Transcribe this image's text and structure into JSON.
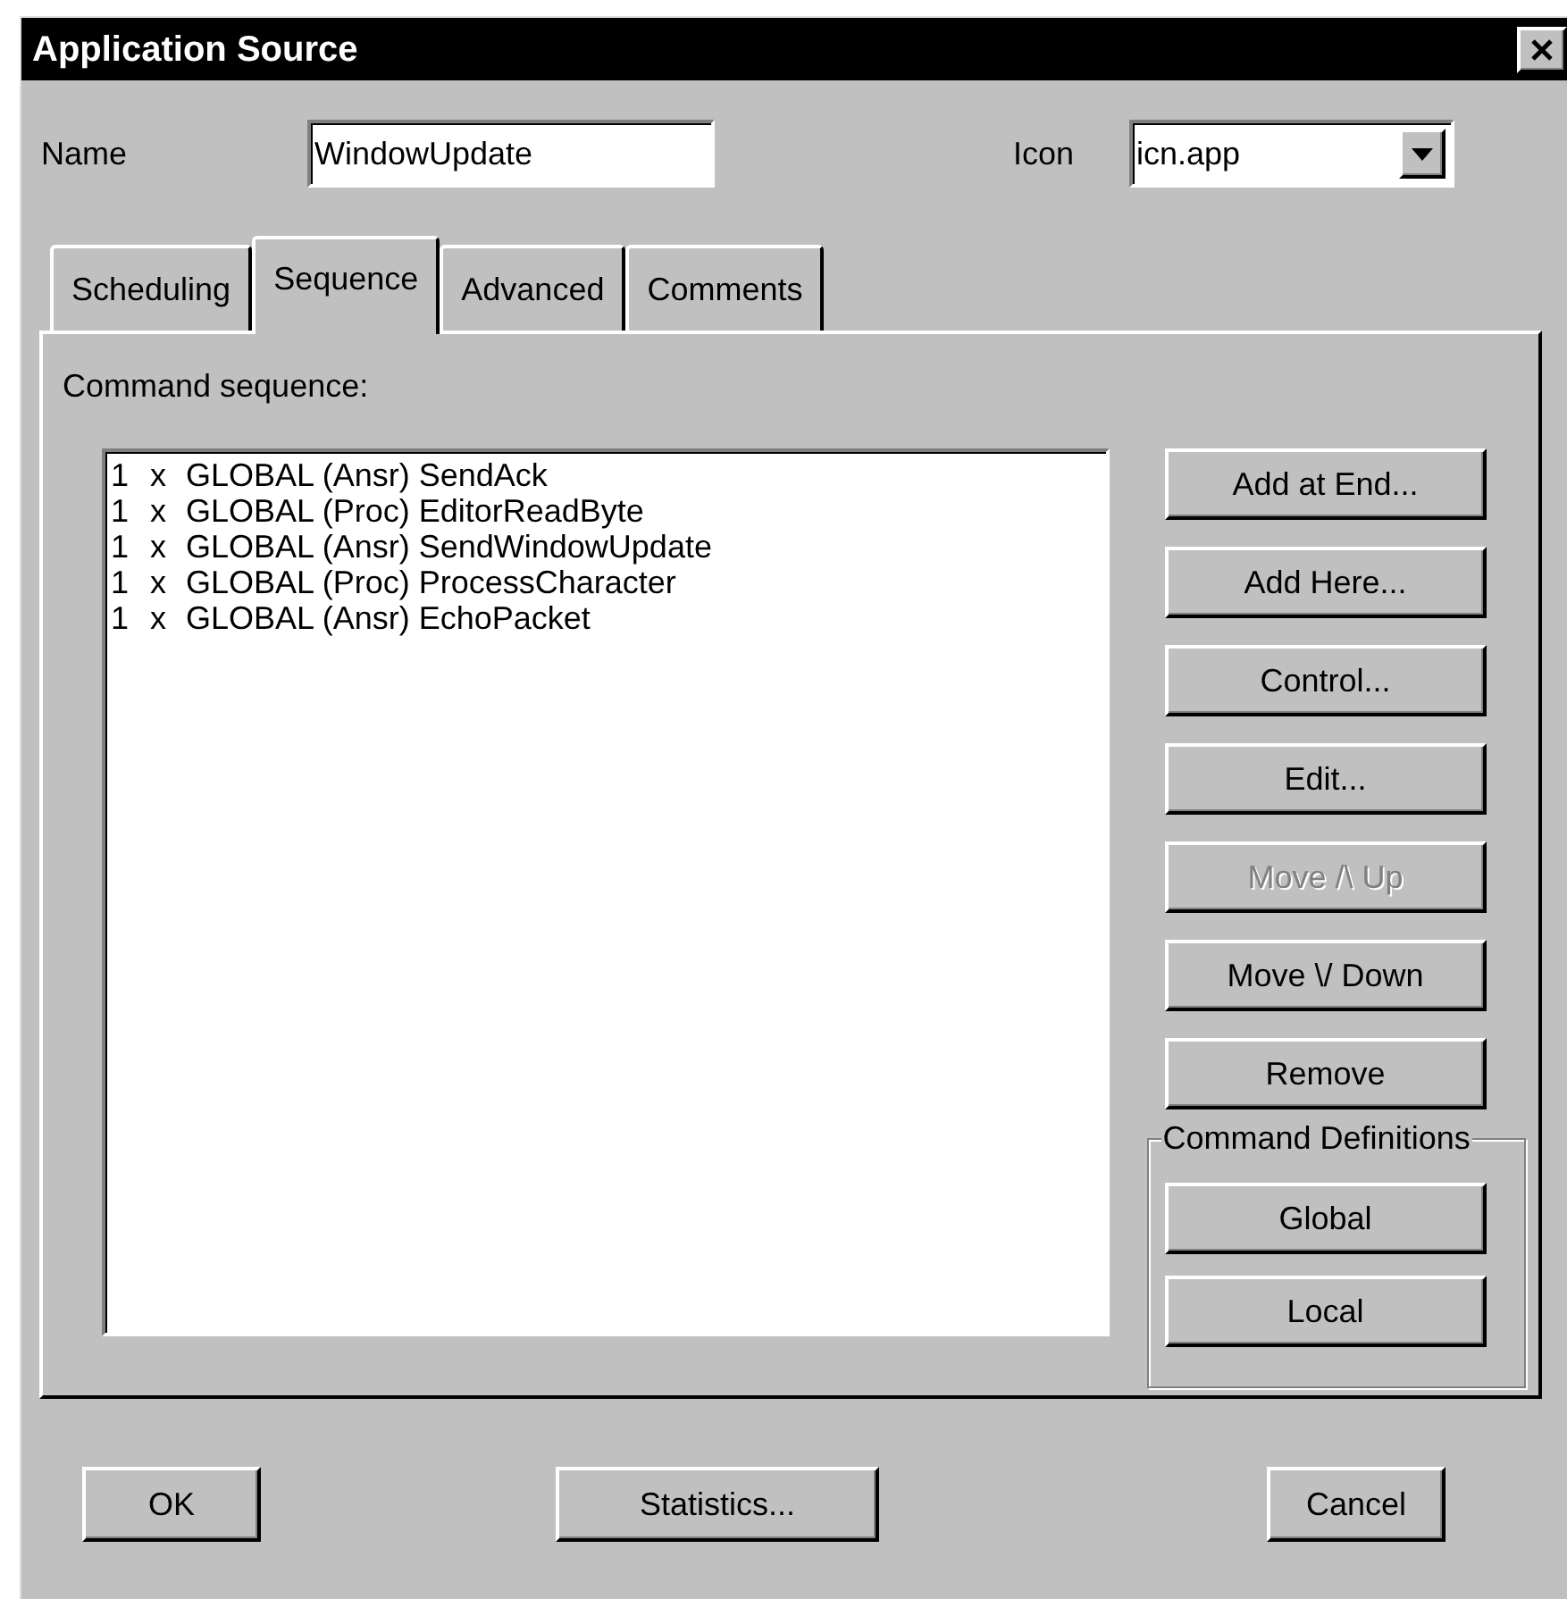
{
  "window": {
    "title": "Application Source"
  },
  "name_field": {
    "label": "Name",
    "value": "WindowUpdate"
  },
  "icon_field": {
    "label": "Icon",
    "value": "icn.app"
  },
  "tabs": [
    {
      "label": "Scheduling",
      "selected": false
    },
    {
      "label": "Sequence",
      "selected": true
    },
    {
      "label": "Advanced",
      "selected": false
    },
    {
      "label": "Comments",
      "selected": false
    }
  ],
  "command_sequence": {
    "label": "Command sequence:",
    "items": [
      {
        "count": "1",
        "multiplier": "x",
        "command": "GLOBAL (Ansr) SendAck"
      },
      {
        "count": "1",
        "multiplier": "x",
        "command": "GLOBAL (Proc) EditorReadByte"
      },
      {
        "count": "1",
        "multiplier": "x",
        "command": "GLOBAL (Ansr) SendWindowUpdate"
      },
      {
        "count": "1",
        "multiplier": "x",
        "command": "GLOBAL (Proc) ProcessCharacter"
      },
      {
        "count": "1",
        "multiplier": "x",
        "command": "GLOBAL (Ansr) EchoPacket"
      }
    ]
  },
  "side_buttons": [
    {
      "label": "Add at End...",
      "disabled": false
    },
    {
      "label": "Add Here...",
      "disabled": false
    },
    {
      "label": "Control...",
      "disabled": false
    },
    {
      "label": "Edit...",
      "disabled": false
    },
    {
      "label": "Move /\\ Up",
      "disabled": true
    },
    {
      "label": "Move \\/ Down",
      "disabled": false
    },
    {
      "label": "Remove",
      "disabled": false
    }
  ],
  "command_definitions": {
    "label": "Command Definitions",
    "buttons": [
      "Global",
      "Local"
    ]
  },
  "footer_buttons": [
    "OK",
    "Statistics...",
    "Cancel"
  ]
}
